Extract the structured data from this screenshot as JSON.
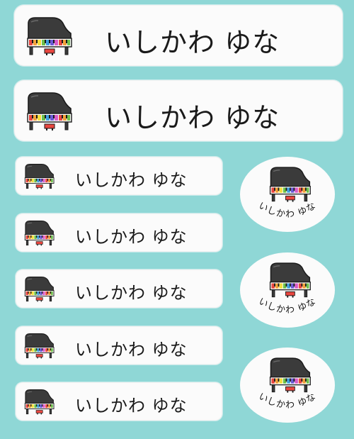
{
  "sheet": {
    "background_color": "#8fd7d6",
    "label_color": "#fbfbfb"
  },
  "labels": {
    "large": [
      {
        "name": "いしかわ ゆな",
        "icon": "grand-piano-icon"
      },
      {
        "name": "いしかわ ゆな",
        "icon": "grand-piano-icon"
      }
    ],
    "small": [
      {
        "name": "いしかわ ゆな",
        "icon": "grand-piano-icon"
      },
      {
        "name": "いしかわ ゆな",
        "icon": "grand-piano-icon"
      },
      {
        "name": "いしかわ ゆな",
        "icon": "grand-piano-icon"
      },
      {
        "name": "いしかわ ゆな",
        "icon": "grand-piano-icon"
      },
      {
        "name": "いしかわ ゆな",
        "icon": "grand-piano-icon"
      }
    ],
    "oval": [
      {
        "name": "いしかわ ゆな",
        "icon": "grand-piano-icon"
      },
      {
        "name": "いしかわ ゆな",
        "icon": "grand-piano-icon"
      },
      {
        "name": "いしかわ ゆな",
        "icon": "grand-piano-icon"
      }
    ]
  },
  "piano_key_colors": [
    "#e8463f",
    "#f3a23a",
    "#f4de3c",
    "#6cc04a",
    "#3f9fe0",
    "#6a5bd6",
    "#d85bc8",
    "#e8463f",
    "#f3a23a",
    "#6cc04a"
  ]
}
